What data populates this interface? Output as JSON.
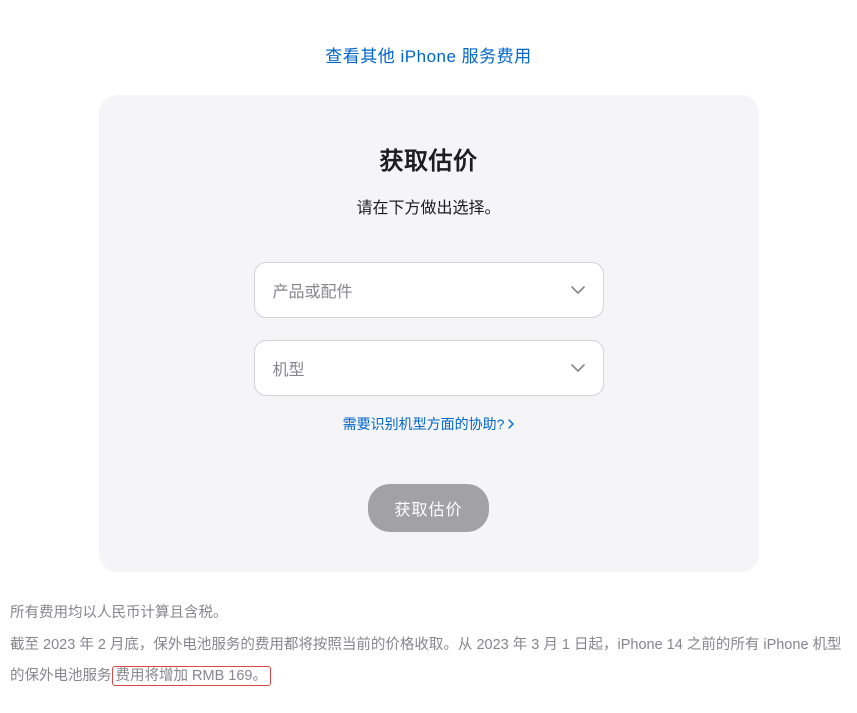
{
  "top_link": {
    "label": "查看其他 iPhone 服务费用"
  },
  "card": {
    "title": "获取估价",
    "subtitle": "请在下方做出选择。",
    "select_product_placeholder": "产品或配件",
    "select_model_placeholder": "机型",
    "help_link_label": "需要识别机型方面的协助?",
    "submit_label": "获取估价"
  },
  "footer": {
    "line1": "所有费用均以人民币计算且含税。",
    "line2_part1": "截至 2023 年 2 月底，保外电池服务的费用都将按照当前的价格收取。从 2023 年 3 月 1 日起，iPhone 14 之前的所有 iPhone 机型的保外电池服务",
    "line2_highlight": "费用将增加 RMB 169。"
  }
}
